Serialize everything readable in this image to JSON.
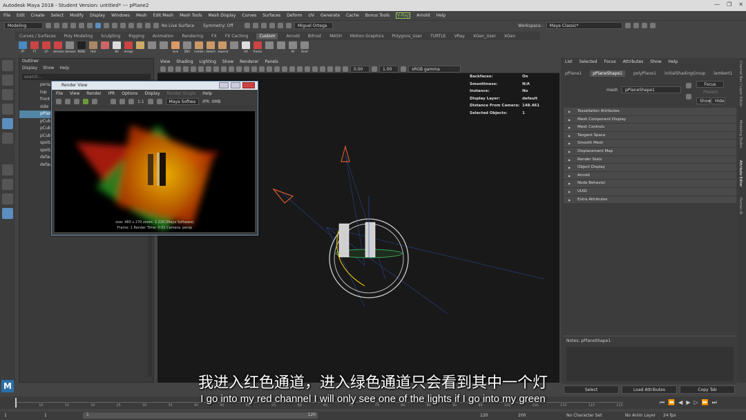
{
  "window": {
    "title": "Autodesk Maya 2018 - Student Version: untitled*   ---   pPlane2",
    "controls": [
      "—",
      "❐",
      "✕"
    ]
  },
  "menubar": [
    "File",
    "Edit",
    "Create",
    "Select",
    "Modify",
    "Display",
    "Windows",
    "Mesh",
    "Edit Mesh",
    "Mesh Tools",
    "Mesh Display",
    "Curves",
    "Surfaces",
    "Deform",
    "UV",
    "Generate",
    "Cache",
    "Bonus Tools",
    "V-Ray",
    "Arnold",
    "Help"
  ],
  "statusline": {
    "mode": "Modeling",
    "live_surface": "No Live Surface",
    "symmetry": "Symmetry: Off",
    "user": "Miguel Ortega",
    "workspace_label": "Workspace :",
    "workspace": "Maya Classic*"
  },
  "shelf_tabs": [
    "Curves / Surfaces",
    "Poly Modeling",
    "Sculpting",
    "Rigging",
    "Animation",
    "Rendering",
    "FX",
    "FX Caching",
    "Custom",
    "Arnold",
    "Bifrost",
    "MASH",
    "Motion Graphics",
    "Polygons_User",
    "TURTLE",
    "VRay",
    "XGen_User",
    "XGen"
  ],
  "shelf_active": "Custom",
  "shelf_tools": [
    "RT",
    "FT",
    "CP",
    "denoise",
    "denoise",
    "NUKE",
    "Hist",
    "",
    "BS",
    "merge",
    "",
    "",
    "",
    "love",
    "DStr",
    "combin",
    "detach",
    "seperat",
    "",
    "UV",
    "freeze",
    "",
    "",
    "All",
    "Dont"
  ],
  "outliner": {
    "title": "Outliner",
    "menu": [
      "Display",
      "Show",
      "Help"
    ],
    "search_placeholder": "search...",
    "rows": [
      "persp",
      "top",
      "front",
      "side",
      "pPlane2",
      "pCube1",
      "pCube2",
      "pCube3",
      "spotLight1",
      "spotLight2",
      "defaultLightSet",
      "defaultObjectSet"
    ],
    "selected_index": 4
  },
  "viewport": {
    "menu": [
      "View",
      "Shading",
      "Lighting",
      "Show",
      "Renderer",
      "Panels"
    ],
    "value_a": "0.00",
    "value_b": "1.00",
    "color_space": "sRGB gamma",
    "hud": [
      {
        "k": "Backfaces:",
        "v": "On"
      },
      {
        "k": "Smoothness:",
        "v": "N/A"
      },
      {
        "k": "Instance:",
        "v": "No"
      },
      {
        "k": "Display Layer:",
        "v": "default"
      },
      {
        "k": "Distance From Camera:",
        "v": "148.461"
      },
      {
        "k": "Selected Objects:",
        "v": "1"
      }
    ]
  },
  "render_view": {
    "title": "Render View",
    "menu": [
      "File",
      "View",
      "Render",
      "IPR",
      "Options",
      "Display",
      "Render Single",
      "Help"
    ],
    "ratio": "1:1",
    "renderer": "Maya Softwa",
    "ipr": "IPR: 0MB",
    "caption_line1": "size: 480 x 270  zoom: 2.220          (Maya Software)",
    "caption_line2": "Frame: 1          Render Time: 0:01          Camera: persp"
  },
  "attribute_editor": {
    "menu": [
      "List",
      "Selected",
      "Focus",
      "Attributes",
      "Show",
      "Help"
    ],
    "tabs": [
      "pPlane1",
      "pPlaneShape1",
      "polyPlane1",
      "initialShadingGroup",
      "lambert1"
    ],
    "active_tab": "pPlaneShape1",
    "mesh_label": "mesh",
    "mesh_value": "pPlaneShape1",
    "focus": "Focus",
    "presets": "Presets",
    "show": "Show",
    "hide": "Hide",
    "sections": [
      "Tessellation Attributes",
      "Mesh Component Display",
      "Mesh Controls",
      "Tangent Space",
      "Smooth Mesh",
      "Displacement Map",
      "Render Stats",
      "Object Display",
      "Arnold",
      "Node Behavior",
      "UUID",
      "Extra Attributes"
    ],
    "notes": "Notes:  pPlaneShape1",
    "buttons": [
      "Select",
      "Load Attributes",
      "Copy Tab"
    ]
  },
  "right_strip": [
    "Channel Box / Layer Editor",
    "Modeling Toolkit",
    "Attribute Editor",
    "Human IK"
  ],
  "timeline": {
    "ticks": [
      "5",
      "10",
      "15",
      "20",
      "25",
      "30",
      "35",
      "40",
      "45",
      "50",
      "55",
      "60",
      "65",
      "70",
      "75",
      "80",
      "85",
      "90",
      "95",
      "100",
      "105",
      "110",
      "115",
      "120"
    ],
    "range_start": "1",
    "range_start2": "1",
    "range_mid": "120",
    "range_end": "120",
    "range_end2": "200",
    "character_set": "No Character Set",
    "anim_layer": "No Anim Layer",
    "fps": "24 fps"
  },
  "subtitles": {
    "cn": "我进入红色通道，进入绿色通道只会看到其中一个灯",
    "en": "I go into my red channel I will only see one of the lights if I go into my green"
  }
}
